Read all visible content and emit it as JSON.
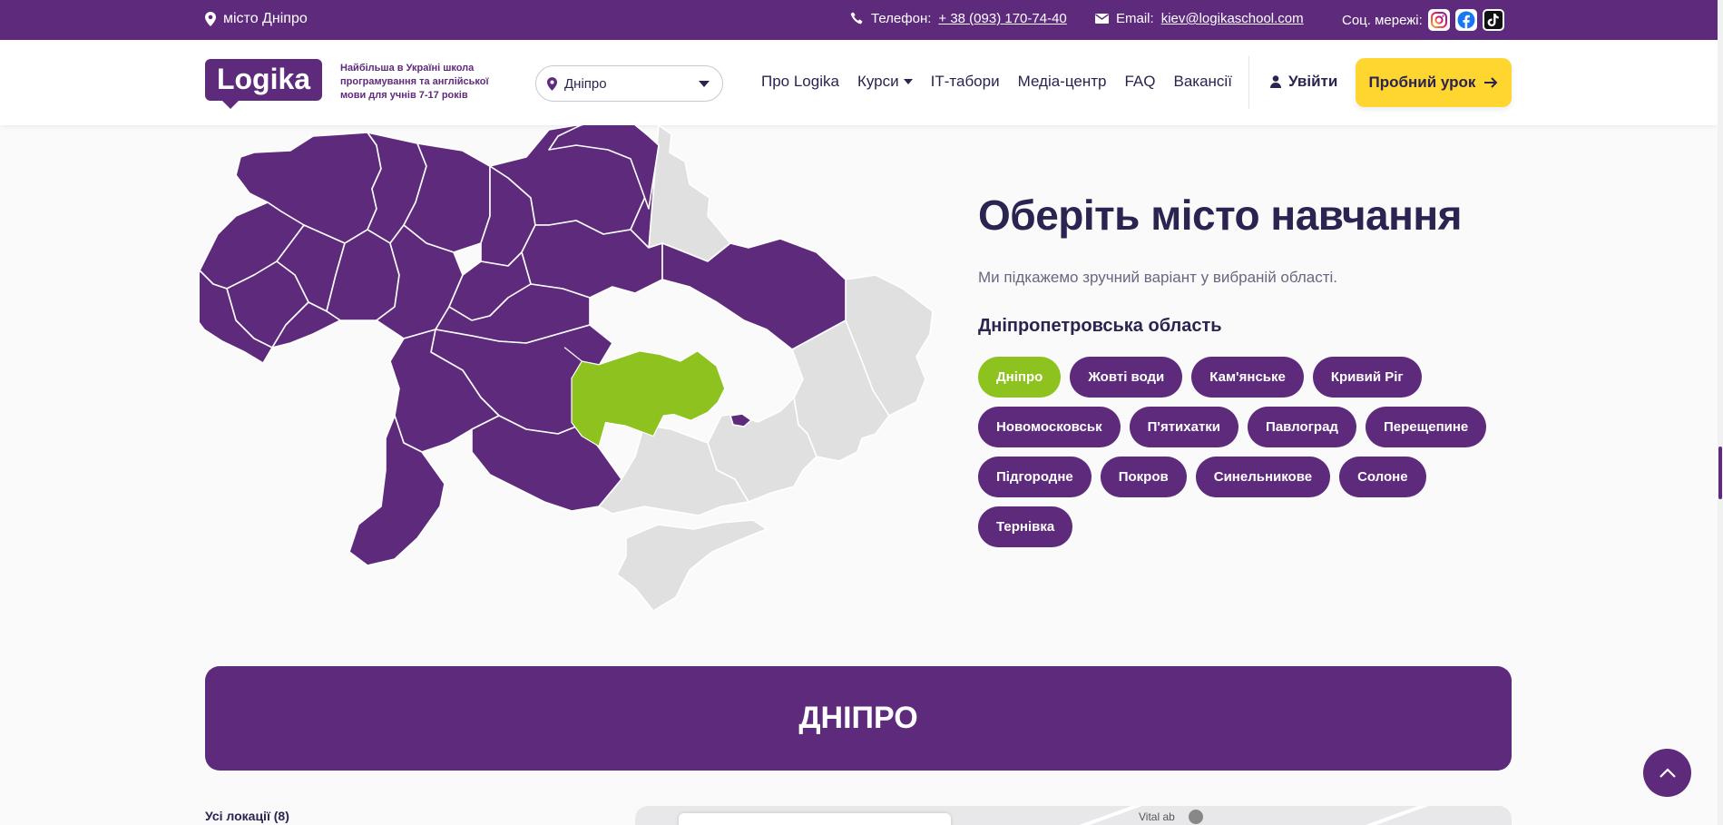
{
  "topbar": {
    "city": "місто Дніпро",
    "phone_label": "Телефон:",
    "phone": "+ 38 (093) 170-74-40",
    "email_label": "Email:",
    "email": "kiev@logikaschool.com",
    "social_label": "Соц. мережі:",
    "social_icons": [
      "instagram-icon",
      "facebook-icon",
      "tiktok-icon"
    ]
  },
  "header": {
    "logo": "Logika",
    "tagline": "Найбільша в Україні школа програмування та англійської мови для учнів 7-17 років",
    "city_select": "Дніпро",
    "nav": [
      "Про Logika",
      "Курси",
      "ІТ-табори",
      "Медіа-центр",
      "FAQ",
      "Вакансії"
    ],
    "login": "Увійти",
    "trial": "Пробний урок"
  },
  "hero": {
    "title": "Оберіть місто навчання",
    "subtitle": "Ми підкажемо зручний варіант у вибраній області.",
    "region": "Дніпропетровська область",
    "cities": [
      "Дніпро",
      "Жовті води",
      "Кам'янське",
      "Кривий Ріг",
      "Новомосковськ",
      "П'ятихатки",
      "Павлоград",
      "Перещепине",
      "Підгородне",
      "Покров",
      "Синельникове",
      "Солоне",
      "Тернівка"
    ],
    "active_city": "Дніпро"
  },
  "banner": {
    "title": "ДНІПРО"
  },
  "locations": {
    "label": "Усі локації (8)",
    "map_label": "Vital ab"
  },
  "colors": {
    "brand": "#5e2b7c",
    "accent": "#ffd530",
    "active": "#8dc21f",
    "inactive_region": "#e0e0e0"
  }
}
